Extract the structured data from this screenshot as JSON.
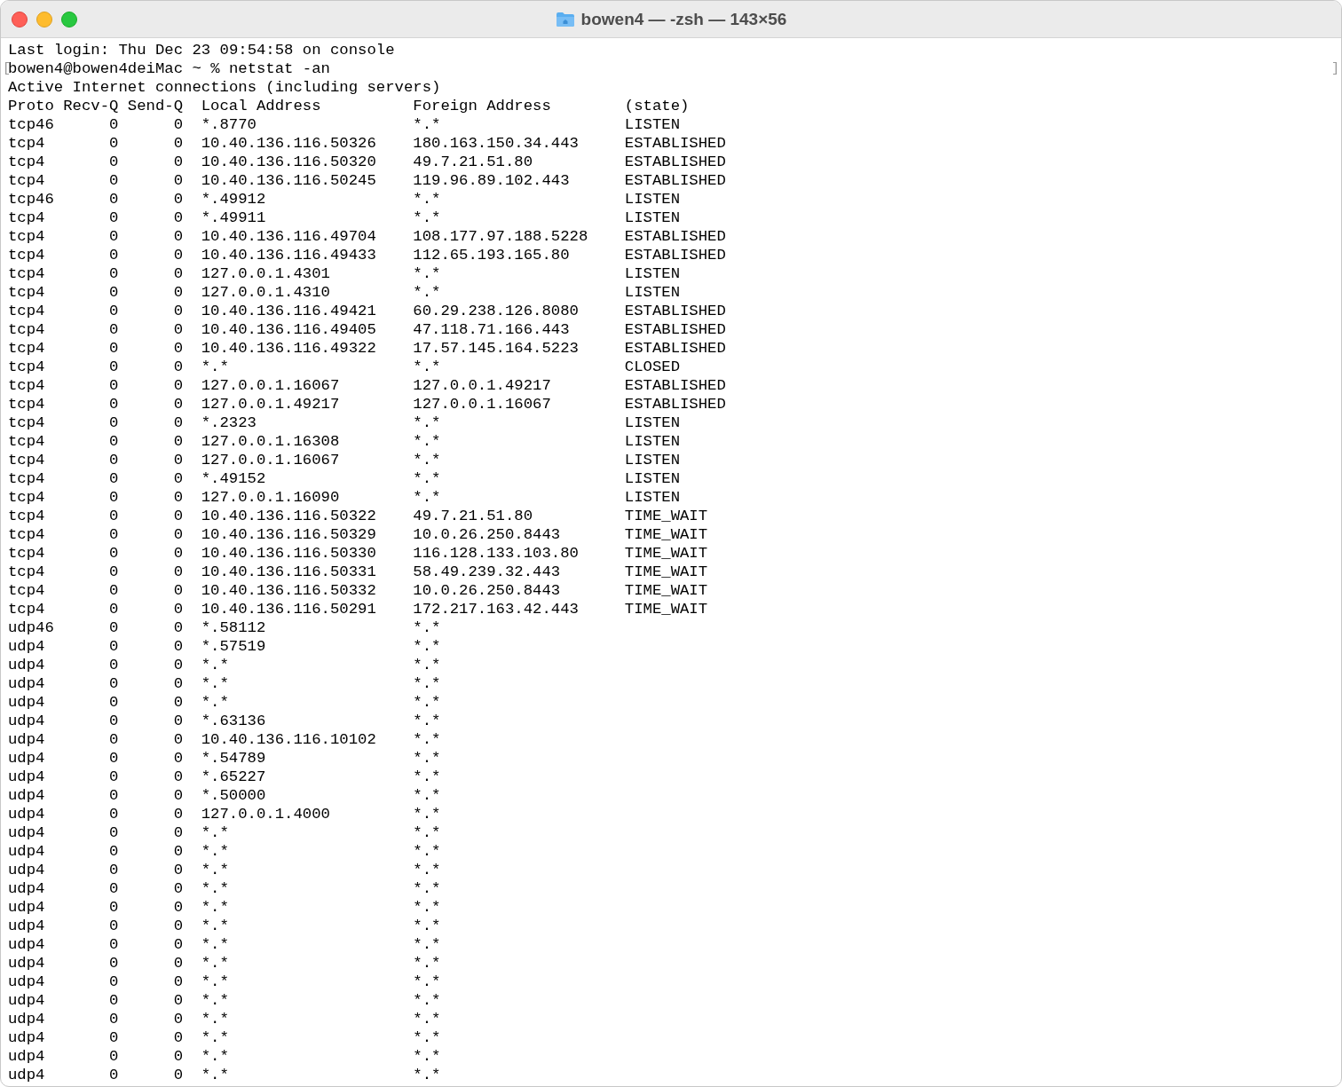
{
  "window": {
    "title": "bowen4 — -zsh — 143×56"
  },
  "terminal": {
    "login_line": "Last login: Thu Dec 23 09:54:58 on console",
    "prompt": {
      "text": "bowen4@bowen4deiMac ~ % netstat -an",
      "mark_start": "[",
      "mark_end": "]"
    },
    "output_title": "Active Internet connections (including servers)",
    "columns": [
      "Proto",
      "Recv-Q",
      "Send-Q",
      "Local Address",
      "Foreign Address",
      "(state)"
    ],
    "rows": [
      {
        "proto": "tcp46",
        "recv_q": "0",
        "send_q": "0",
        "local": "*.8770",
        "foreign": "*.*",
        "state": "LISTEN"
      },
      {
        "proto": "tcp4",
        "recv_q": "0",
        "send_q": "0",
        "local": "10.40.136.116.50326",
        "foreign": "180.163.150.34.443",
        "state": "ESTABLISHED"
      },
      {
        "proto": "tcp4",
        "recv_q": "0",
        "send_q": "0",
        "local": "10.40.136.116.50320",
        "foreign": "49.7.21.51.80",
        "state": "ESTABLISHED"
      },
      {
        "proto": "tcp4",
        "recv_q": "0",
        "send_q": "0",
        "local": "10.40.136.116.50245",
        "foreign": "119.96.89.102.443",
        "state": "ESTABLISHED"
      },
      {
        "proto": "tcp46",
        "recv_q": "0",
        "send_q": "0",
        "local": "*.49912",
        "foreign": "*.*",
        "state": "LISTEN"
      },
      {
        "proto": "tcp4",
        "recv_q": "0",
        "send_q": "0",
        "local": "*.49911",
        "foreign": "*.*",
        "state": "LISTEN"
      },
      {
        "proto": "tcp4",
        "recv_q": "0",
        "send_q": "0",
        "local": "10.40.136.116.49704",
        "foreign": "108.177.97.188.5228",
        "state": "ESTABLISHED"
      },
      {
        "proto": "tcp4",
        "recv_q": "0",
        "send_q": "0",
        "local": "10.40.136.116.49433",
        "foreign": "112.65.193.165.80",
        "state": "ESTABLISHED"
      },
      {
        "proto": "tcp4",
        "recv_q": "0",
        "send_q": "0",
        "local": "127.0.0.1.4301",
        "foreign": "*.*",
        "state": "LISTEN"
      },
      {
        "proto": "tcp4",
        "recv_q": "0",
        "send_q": "0",
        "local": "127.0.0.1.4310",
        "foreign": "*.*",
        "state": "LISTEN"
      },
      {
        "proto": "tcp4",
        "recv_q": "0",
        "send_q": "0",
        "local": "10.40.136.116.49421",
        "foreign": "60.29.238.126.8080",
        "state": "ESTABLISHED"
      },
      {
        "proto": "tcp4",
        "recv_q": "0",
        "send_q": "0",
        "local": "10.40.136.116.49405",
        "foreign": "47.118.71.166.443",
        "state": "ESTABLISHED"
      },
      {
        "proto": "tcp4",
        "recv_q": "0",
        "send_q": "0",
        "local": "10.40.136.116.49322",
        "foreign": "17.57.145.164.5223",
        "state": "ESTABLISHED"
      },
      {
        "proto": "tcp4",
        "recv_q": "0",
        "send_q": "0",
        "local": "*.*",
        "foreign": "*.*",
        "state": "CLOSED"
      },
      {
        "proto": "tcp4",
        "recv_q": "0",
        "send_q": "0",
        "local": "127.0.0.1.16067",
        "foreign": "127.0.0.1.49217",
        "state": "ESTABLISHED"
      },
      {
        "proto": "tcp4",
        "recv_q": "0",
        "send_q": "0",
        "local": "127.0.0.1.49217",
        "foreign": "127.0.0.1.16067",
        "state": "ESTABLISHED"
      },
      {
        "proto": "tcp4",
        "recv_q": "0",
        "send_q": "0",
        "local": "*.2323",
        "foreign": "*.*",
        "state": "LISTEN"
      },
      {
        "proto": "tcp4",
        "recv_q": "0",
        "send_q": "0",
        "local": "127.0.0.1.16308",
        "foreign": "*.*",
        "state": "LISTEN"
      },
      {
        "proto": "tcp4",
        "recv_q": "0",
        "send_q": "0",
        "local": "127.0.0.1.16067",
        "foreign": "*.*",
        "state": "LISTEN"
      },
      {
        "proto": "tcp4",
        "recv_q": "0",
        "send_q": "0",
        "local": "*.49152",
        "foreign": "*.*",
        "state": "LISTEN"
      },
      {
        "proto": "tcp4",
        "recv_q": "0",
        "send_q": "0",
        "local": "127.0.0.1.16090",
        "foreign": "*.*",
        "state": "LISTEN"
      },
      {
        "proto": "tcp4",
        "recv_q": "0",
        "send_q": "0",
        "local": "10.40.136.116.50322",
        "foreign": "49.7.21.51.80",
        "state": "TIME_WAIT"
      },
      {
        "proto": "tcp4",
        "recv_q": "0",
        "send_q": "0",
        "local": "10.40.136.116.50329",
        "foreign": "10.0.26.250.8443",
        "state": "TIME_WAIT"
      },
      {
        "proto": "tcp4",
        "recv_q": "0",
        "send_q": "0",
        "local": "10.40.136.116.50330",
        "foreign": "116.128.133.103.80",
        "state": "TIME_WAIT"
      },
      {
        "proto": "tcp4",
        "recv_q": "0",
        "send_q": "0",
        "local": "10.40.136.116.50331",
        "foreign": "58.49.239.32.443",
        "state": "TIME_WAIT"
      },
      {
        "proto": "tcp4",
        "recv_q": "0",
        "send_q": "0",
        "local": "10.40.136.116.50332",
        "foreign": "10.0.26.250.8443",
        "state": "TIME_WAIT"
      },
      {
        "proto": "tcp4",
        "recv_q": "0",
        "send_q": "0",
        "local": "10.40.136.116.50291",
        "foreign": "172.217.163.42.443",
        "state": "TIME_WAIT"
      },
      {
        "proto": "udp46",
        "recv_q": "0",
        "send_q": "0",
        "local": "*.58112",
        "foreign": "*.*"
      },
      {
        "proto": "udp4",
        "recv_q": "0",
        "send_q": "0",
        "local": "*.57519",
        "foreign": "*.*"
      },
      {
        "proto": "udp4",
        "recv_q": "0",
        "send_q": "0",
        "local": "*.*",
        "foreign": "*.*"
      },
      {
        "proto": "udp4",
        "recv_q": "0",
        "send_q": "0",
        "local": "*.*",
        "foreign": "*.*"
      },
      {
        "proto": "udp4",
        "recv_q": "0",
        "send_q": "0",
        "local": "*.*",
        "foreign": "*.*"
      },
      {
        "proto": "udp4",
        "recv_q": "0",
        "send_q": "0",
        "local": "*.63136",
        "foreign": "*.*"
      },
      {
        "proto": "udp4",
        "recv_q": "0",
        "send_q": "0",
        "local": "10.40.136.116.10102",
        "foreign": "*.*"
      },
      {
        "proto": "udp4",
        "recv_q": "0",
        "send_q": "0",
        "local": "*.54789",
        "foreign": "*.*"
      },
      {
        "proto": "udp4",
        "recv_q": "0",
        "send_q": "0",
        "local": "*.65227",
        "foreign": "*.*"
      },
      {
        "proto": "udp4",
        "recv_q": "0",
        "send_q": "0",
        "local": "*.50000",
        "foreign": "*.*"
      },
      {
        "proto": "udp4",
        "recv_q": "0",
        "send_q": "0",
        "local": "127.0.0.1.4000",
        "foreign": "*.*"
      },
      {
        "proto": "udp4",
        "recv_q": "0",
        "send_q": "0",
        "local": "*.*",
        "foreign": "*.*"
      },
      {
        "proto": "udp4",
        "recv_q": "0",
        "send_q": "0",
        "local": "*.*",
        "foreign": "*.*"
      },
      {
        "proto": "udp4",
        "recv_q": "0",
        "send_q": "0",
        "local": "*.*",
        "foreign": "*.*"
      },
      {
        "proto": "udp4",
        "recv_q": "0",
        "send_q": "0",
        "local": "*.*",
        "foreign": "*.*"
      },
      {
        "proto": "udp4",
        "recv_q": "0",
        "send_q": "0",
        "local": "*.*",
        "foreign": "*.*"
      },
      {
        "proto": "udp4",
        "recv_q": "0",
        "send_q": "0",
        "local": "*.*",
        "foreign": "*.*"
      },
      {
        "proto": "udp4",
        "recv_q": "0",
        "send_q": "0",
        "local": "*.*",
        "foreign": "*.*"
      },
      {
        "proto": "udp4",
        "recv_q": "0",
        "send_q": "0",
        "local": "*.*",
        "foreign": "*.*"
      },
      {
        "proto": "udp4",
        "recv_q": "0",
        "send_q": "0",
        "local": "*.*",
        "foreign": "*.*"
      },
      {
        "proto": "udp4",
        "recv_q": "0",
        "send_q": "0",
        "local": "*.*",
        "foreign": "*.*"
      },
      {
        "proto": "udp4",
        "recv_q": "0",
        "send_q": "0",
        "local": "*.*",
        "foreign": "*.*"
      },
      {
        "proto": "udp4",
        "recv_q": "0",
        "send_q": "0",
        "local": "*.*",
        "foreign": "*.*"
      },
      {
        "proto": "udp4",
        "recv_q": "0",
        "send_q": "0",
        "local": "*.*",
        "foreign": "*.*"
      },
      {
        "proto": "udp4",
        "recv_q": "0",
        "send_q": "0",
        "local": "*.*",
        "foreign": "*.*"
      }
    ]
  }
}
